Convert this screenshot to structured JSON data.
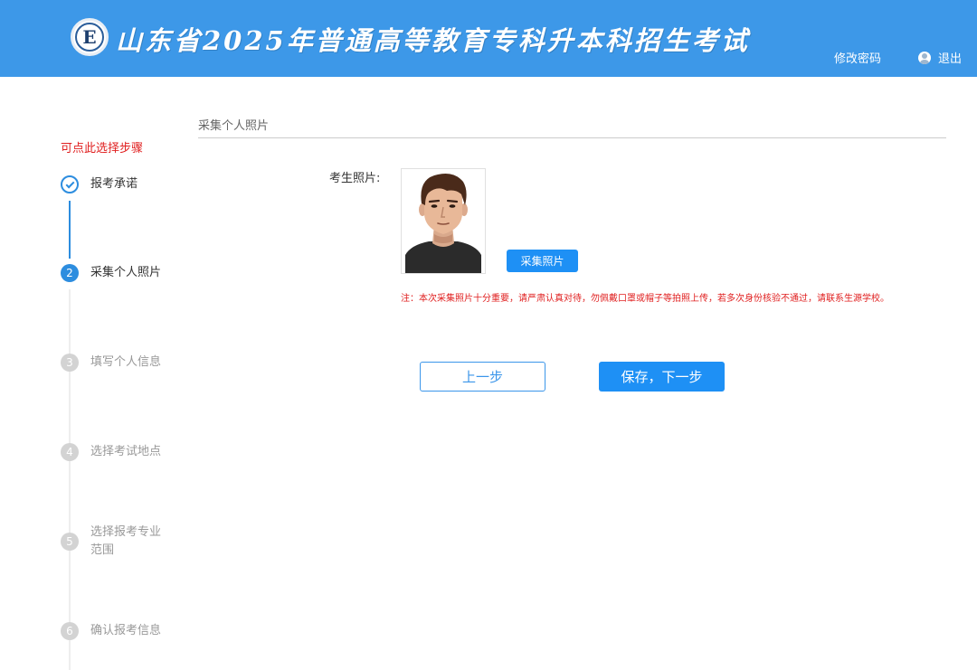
{
  "header": {
    "logo_letter": "E",
    "title": "山东省2025年普通高等教育专科升本科招生考试",
    "change_password": "修改密码",
    "logout": "退出"
  },
  "sidebar": {
    "hint": "可点此选择步骤",
    "steps": [
      {
        "number": "1",
        "label": "报考承诺",
        "state": "done"
      },
      {
        "number": "2",
        "label": "采集个人照片",
        "state": "active"
      },
      {
        "number": "3",
        "label": "填写个人信息",
        "state": "todo"
      },
      {
        "number": "4",
        "label": "选择考试地点",
        "state": "todo"
      },
      {
        "number": "5",
        "label": "选择报考专业\n范围",
        "state": "todo"
      },
      {
        "number": "6",
        "label": "确认报考信息",
        "state": "todo"
      }
    ]
  },
  "main": {
    "section_title": "采集个人照片",
    "photo_label": "考生照片:",
    "capture_button": "采集照片",
    "notice": "注：本次采集照片十分重要，请严肃认真对待，勿佩戴口罩或帽子等拍照上传，若多次身份核验不通过，请联系生源学校。",
    "prev_button": "上一步",
    "next_button": "保存，下一步"
  },
  "colors": {
    "header_bg": "#3d98e8",
    "primary": "#1e90f5",
    "warning": "#e02020",
    "step_done": "#2d8ddf",
    "step_todo": "#d3d3d3"
  }
}
